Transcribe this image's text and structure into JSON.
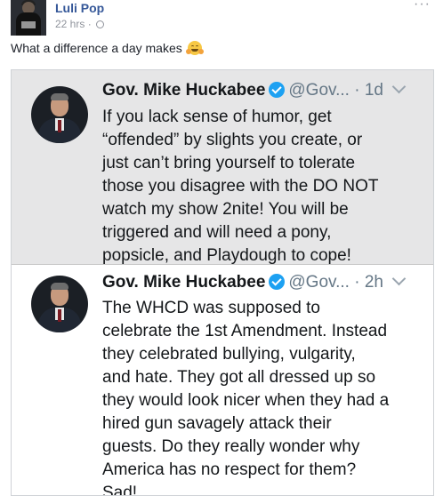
{
  "post": {
    "author": "Luli Pop",
    "time": "22 hrs",
    "separator": "·",
    "more": "···",
    "caption": "What a difference a day makes"
  },
  "tweets": [
    {
      "name": "Gov. Mike Huckabee",
      "handle": "@Gov...",
      "time": "1d",
      "text": "If you lack sense of humor, get\n“offended” by slights you create, or\njust can’t bring yourself to tolerate\nthose you disagree with the DO NOT\nwatch my show 2nite!  You will be\ntriggered and will need a pony,\npopsicle, and Playdough to cope!"
    },
    {
      "name": "Gov. Mike Huckabee",
      "handle": "@Gov...",
      "time": "2h",
      "text": "The WHCD was supposed to\ncelebrate the 1st Amendment.  Instead\nthey celebrated bullying, vulgarity,\nand hate. They got all dressed up so\nthey would look nicer when they had a\nhired gun savagely attack their\nguests. Do they really wonder why\nAmerica has no respect for them?\nSad!"
    }
  ],
  "colors": {
    "author_link": "#365899",
    "verified": "#1da1f2",
    "tweet1_background": "#e6e6e7"
  },
  "icons": [
    "globe-icon",
    "more-icon",
    "hugging-face-emoji",
    "verified-icon",
    "chevron-down-icon"
  ]
}
